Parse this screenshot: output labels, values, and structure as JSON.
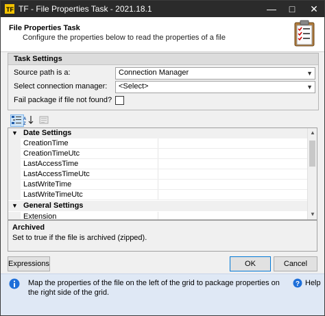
{
  "window": {
    "title": "TF - File Properties Task - 2021.18.1",
    "minimize": "—",
    "maximize": "□",
    "close": "✕"
  },
  "header": {
    "title": "File Properties Task",
    "subtitle": "Configure the properties below to read the properties of a file"
  },
  "task_settings": {
    "title": "Task Settings",
    "source_path_label": "Source path is a:",
    "source_path_value": "Connection Manager",
    "connection_label": "Select connection manager:",
    "connection_value": "<Select>",
    "fail_label": "Fail package if file not found?",
    "fail_checked": false
  },
  "grid": {
    "categories": [
      {
        "name": "Date Settings",
        "items": [
          "CreationTime",
          "CreationTimeUtc",
          "LastAccessTime",
          "LastAccessTimeUtc",
          "LastWriteTime",
          "LastWriteTimeUtc"
        ]
      },
      {
        "name": "General Settings",
        "items": [
          "Extension"
        ]
      }
    ]
  },
  "description": {
    "title": "Archived",
    "text": "Set to true if the file is archived (zipped)."
  },
  "buttons": {
    "expressions": "Expressions",
    "ok": "OK",
    "cancel": "Cancel"
  },
  "footer": {
    "text": "Map the properties of the file on the left of the grid to package properties on the right side of the grid.",
    "help": "Help"
  },
  "icons": [
    "app-icon",
    "checklist-icon",
    "categorized-sort-icon",
    "alphabetical-sort-icon",
    "property-pages-icon",
    "info-icon",
    "help-icon"
  ]
}
